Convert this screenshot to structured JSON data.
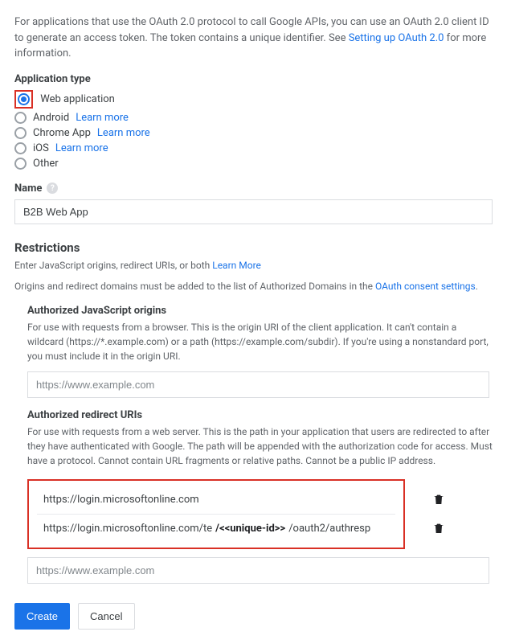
{
  "intro": {
    "text_before": "For applications that use the OAuth 2.0 protocol to call Google APIs, you can use an OAuth 2.0 client ID to generate an access token. The token contains a unique identifier. See ",
    "link": "Setting up OAuth 2.0",
    "text_after": " for more information."
  },
  "app_type": {
    "label": "Application type",
    "options": [
      {
        "label": "Web application",
        "selected": true,
        "learn_more": null
      },
      {
        "label": "Android",
        "selected": false,
        "learn_more": "Learn more"
      },
      {
        "label": "Chrome App",
        "selected": false,
        "learn_more": "Learn more"
      },
      {
        "label": "iOS",
        "selected": false,
        "learn_more": "Learn more"
      },
      {
        "label": "Other",
        "selected": false,
        "learn_more": null
      }
    ]
  },
  "name": {
    "label": "Name",
    "value": "B2B Web App"
  },
  "restrictions": {
    "heading": "Restrictions",
    "sub1": "Enter JavaScript origins, redirect URIs, or both ",
    "sub_link": "Learn More",
    "domains_text": "Origins and redirect domains must be added to the list of Authorized Domains in the ",
    "domains_link": "OAuth consent settings"
  },
  "js_origins": {
    "label": "Authorized JavaScript origins",
    "desc": "For use with requests from a browser. This is the origin URI of the client application. It can't contain a wildcard (https://*.example.com) or a path (https://example.com/subdir). If you're using a nonstandard port, you must include it in the origin URI.",
    "placeholder": "https://www.example.com"
  },
  "redirect": {
    "label": "Authorized redirect URIs",
    "desc": "For use with requests from a web server. This is the path in your application that users are redirected to after they have authenticated with Google. The path will be appended with the authorization code for access. Must have a protocol. Cannot contain URL fragments or relative paths. Cannot be a public IP address.",
    "entries": [
      {
        "prefix": "https://login.microsoftonline.com",
        "uid": null,
        "suffix": null
      },
      {
        "prefix": "https://login.microsoftonline.com/te",
        "uid": "/<<unique-id>>",
        "suffix": "/oauth2/authresp"
      }
    ],
    "placeholder": "https://www.example.com"
  },
  "buttons": {
    "create": "Create",
    "cancel": "Cancel"
  }
}
